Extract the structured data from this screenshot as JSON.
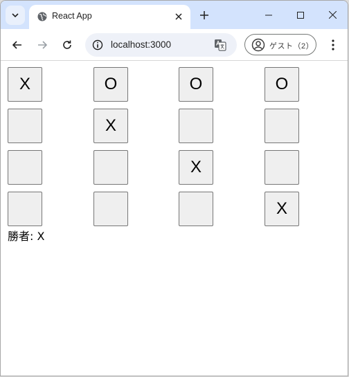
{
  "browser": {
    "tab_title": "React App",
    "url": "localhost:3000",
    "profile_label": "ゲスト（2）"
  },
  "board": {
    "rows": [
      [
        "X",
        "O",
        "O",
        "O"
      ],
      [
        "",
        "X",
        "",
        ""
      ],
      [
        "",
        "",
        "X",
        ""
      ],
      [
        "",
        "",
        "",
        "X"
      ]
    ]
  },
  "status": "勝者: X",
  "colors": {
    "titlebar": "#d3e3fd",
    "cell_bg": "#efefef",
    "cell_border": "#767676"
  }
}
